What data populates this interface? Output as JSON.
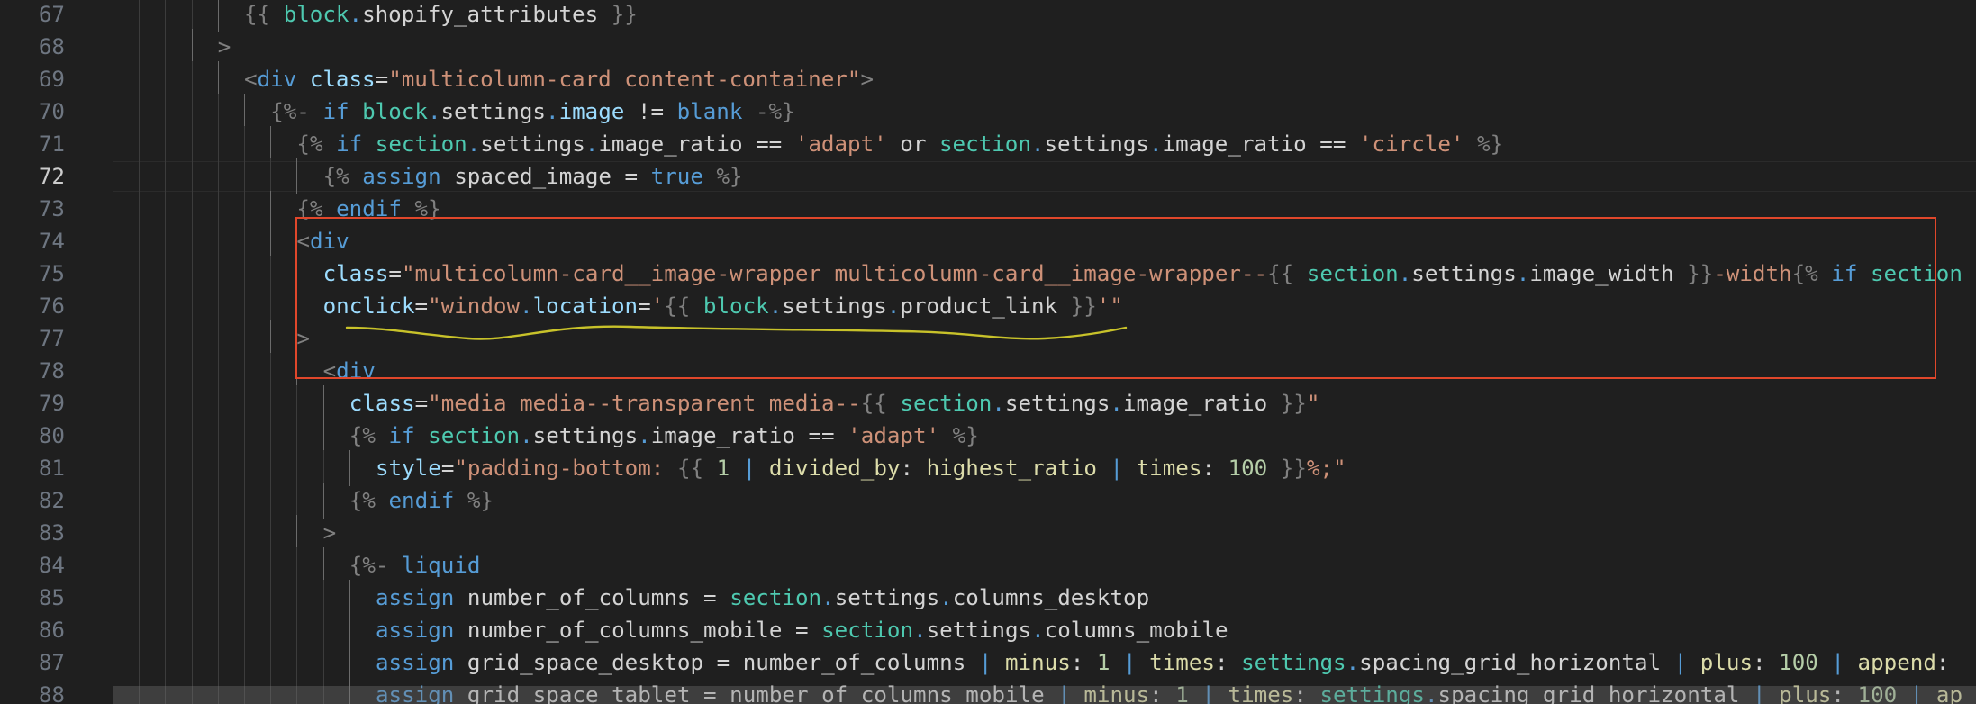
{
  "editor": {
    "current_line": 72,
    "lines": [
      {
        "number": 67,
        "indent": 5,
        "tokens": [
          {
            "t": "{{ ",
            "c": "liq"
          },
          {
            "t": "block",
            "c": "obj"
          },
          {
            "t": ".",
            "c": "dot"
          },
          {
            "t": "shopify_attributes",
            "c": "prop"
          },
          {
            "t": " }}",
            "c": "liq"
          }
        ]
      },
      {
        "number": 68,
        "indent": 4,
        "tokens": [
          {
            "t": ">",
            "c": "punct"
          }
        ]
      },
      {
        "number": 69,
        "indent": 5,
        "tokens": [
          {
            "t": "<",
            "c": "punct"
          },
          {
            "t": "div",
            "c": "tag"
          },
          {
            "t": " ",
            "c": "ident"
          },
          {
            "t": "class",
            "c": "attr"
          },
          {
            "t": "=",
            "c": "ident"
          },
          {
            "t": "\"multicolumn-card content-container\"",
            "c": "str"
          },
          {
            "t": ">",
            "c": "punct"
          }
        ]
      },
      {
        "number": 70,
        "indent": 6,
        "tokens": [
          {
            "t": "{%- ",
            "c": "liq"
          },
          {
            "t": "if",
            "c": "kw"
          },
          {
            "t": " ",
            "c": "ident"
          },
          {
            "t": "block",
            "c": "obj"
          },
          {
            "t": ".",
            "c": "dot"
          },
          {
            "t": "settings",
            "c": "prop"
          },
          {
            "t": ".",
            "c": "dot"
          },
          {
            "t": "image",
            "c": "var"
          },
          {
            "t": " != ",
            "c": "ident"
          },
          {
            "t": "blank",
            "c": "kw"
          },
          {
            "t": " -%}",
            "c": "liq"
          }
        ]
      },
      {
        "number": 71,
        "indent": 7,
        "tokens": [
          {
            "t": "{% ",
            "c": "liq"
          },
          {
            "t": "if",
            "c": "kw"
          },
          {
            "t": " ",
            "c": "ident"
          },
          {
            "t": "section",
            "c": "obj"
          },
          {
            "t": ".",
            "c": "dot"
          },
          {
            "t": "settings",
            "c": "prop"
          },
          {
            "t": ".",
            "c": "dot"
          },
          {
            "t": "image_ratio",
            "c": "prop"
          },
          {
            "t": " == ",
            "c": "ident"
          },
          {
            "t": "'adapt'",
            "c": "str"
          },
          {
            "t": " or ",
            "c": "ident"
          },
          {
            "t": "section",
            "c": "obj"
          },
          {
            "t": ".",
            "c": "dot"
          },
          {
            "t": "settings",
            "c": "prop"
          },
          {
            "t": ".",
            "c": "dot"
          },
          {
            "t": "image_ratio",
            "c": "prop"
          },
          {
            "t": " == ",
            "c": "ident"
          },
          {
            "t": "'circle'",
            "c": "str"
          },
          {
            "t": " %}",
            "c": "liq"
          }
        ]
      },
      {
        "number": 72,
        "indent": 8,
        "tokens": [
          {
            "t": "{% ",
            "c": "liq"
          },
          {
            "t": "assign",
            "c": "kw"
          },
          {
            "t": " spaced_image = ",
            "c": "ident"
          },
          {
            "t": "true",
            "c": "kw"
          },
          {
            "t": " %}",
            "c": "liq"
          }
        ]
      },
      {
        "number": 73,
        "indent": 7,
        "tokens": [
          {
            "t": "{% ",
            "c": "liq"
          },
          {
            "t": "endif",
            "c": "kw"
          },
          {
            "t": " %}",
            "c": "liq"
          }
        ]
      },
      {
        "number": 74,
        "indent": 7,
        "tokens": [
          {
            "t": "<",
            "c": "punct"
          },
          {
            "t": "div",
            "c": "tag"
          }
        ]
      },
      {
        "number": 75,
        "indent": 8,
        "tokens": [
          {
            "t": "class",
            "c": "attr"
          },
          {
            "t": "=",
            "c": "ident"
          },
          {
            "t": "\"multicolumn-card__image-wrapper multicolumn-card__image-wrapper--",
            "c": "str"
          },
          {
            "t": "{{ ",
            "c": "liq"
          },
          {
            "t": "section",
            "c": "obj"
          },
          {
            "t": ".",
            "c": "dot"
          },
          {
            "t": "settings",
            "c": "prop"
          },
          {
            "t": ".",
            "c": "dot"
          },
          {
            "t": "image_width",
            "c": "prop"
          },
          {
            "t": " }}",
            "c": "liq"
          },
          {
            "t": "-width",
            "c": "str"
          },
          {
            "t": "{% ",
            "c": "liq"
          },
          {
            "t": "if",
            "c": "kw"
          },
          {
            "t": " ",
            "c": "ident"
          },
          {
            "t": "section",
            "c": "obj"
          }
        ]
      },
      {
        "number": 76,
        "indent": 8,
        "tokens": [
          {
            "t": "onclick",
            "c": "attr"
          },
          {
            "t": "=",
            "c": "ident"
          },
          {
            "t": "\"window",
            "c": "str"
          },
          {
            "t": ".",
            "c": "dot"
          },
          {
            "t": "location",
            "c": "var"
          },
          {
            "t": "=",
            "c": "ident"
          },
          {
            "t": "'",
            "c": "str"
          },
          {
            "t": "{{ ",
            "c": "liq"
          },
          {
            "t": "block",
            "c": "obj"
          },
          {
            "t": ".",
            "c": "dot"
          },
          {
            "t": "settings",
            "c": "prop"
          },
          {
            "t": ".",
            "c": "dot"
          },
          {
            "t": "product_link",
            "c": "prop"
          },
          {
            "t": " }}",
            "c": "liq"
          },
          {
            "t": "'\"",
            "c": "str"
          }
        ]
      },
      {
        "number": 77,
        "indent": 7,
        "tokens": [
          {
            "t": ">",
            "c": "punct"
          }
        ]
      },
      {
        "number": 78,
        "indent": 8,
        "tokens": [
          {
            "t": "<",
            "c": "punct"
          },
          {
            "t": "div",
            "c": "tag"
          }
        ]
      },
      {
        "number": 79,
        "indent": 9,
        "tokens": [
          {
            "t": "class",
            "c": "attr"
          },
          {
            "t": "=",
            "c": "ident"
          },
          {
            "t": "\"media media--transparent media--",
            "c": "str"
          },
          {
            "t": "{{ ",
            "c": "liq"
          },
          {
            "t": "section",
            "c": "obj"
          },
          {
            "t": ".",
            "c": "dot"
          },
          {
            "t": "settings",
            "c": "prop"
          },
          {
            "t": ".",
            "c": "dot"
          },
          {
            "t": "image_ratio",
            "c": "prop"
          },
          {
            "t": " }}",
            "c": "liq"
          },
          {
            "t": "\"",
            "c": "str"
          }
        ]
      },
      {
        "number": 80,
        "indent": 9,
        "tokens": [
          {
            "t": "{% ",
            "c": "liq"
          },
          {
            "t": "if",
            "c": "kw"
          },
          {
            "t": " ",
            "c": "ident"
          },
          {
            "t": "section",
            "c": "obj"
          },
          {
            "t": ".",
            "c": "dot"
          },
          {
            "t": "settings",
            "c": "prop"
          },
          {
            "t": ".",
            "c": "dot"
          },
          {
            "t": "image_ratio",
            "c": "prop"
          },
          {
            "t": " == ",
            "c": "ident"
          },
          {
            "t": "'adapt'",
            "c": "str"
          },
          {
            "t": " %}",
            "c": "liq"
          }
        ]
      },
      {
        "number": 81,
        "indent": 10,
        "tokens": [
          {
            "t": "style",
            "c": "attr"
          },
          {
            "t": "=",
            "c": "ident"
          },
          {
            "t": "\"padding-bottom: ",
            "c": "str"
          },
          {
            "t": "{{ ",
            "c": "liq"
          },
          {
            "t": "1",
            "c": "num"
          },
          {
            "t": " | ",
            "c": "pipe"
          },
          {
            "t": "divided_by",
            "c": "filter"
          },
          {
            "t": ": ",
            "c": "ident"
          },
          {
            "t": "highest_ratio",
            "c": "filter"
          },
          {
            "t": " | ",
            "c": "pipe"
          },
          {
            "t": "times",
            "c": "filter"
          },
          {
            "t": ": ",
            "c": "ident"
          },
          {
            "t": "100",
            "c": "num"
          },
          {
            "t": " }}",
            "c": "liq"
          },
          {
            "t": "%;\"",
            "c": "str"
          }
        ]
      },
      {
        "number": 82,
        "indent": 9,
        "tokens": [
          {
            "t": "{% ",
            "c": "liq"
          },
          {
            "t": "endif",
            "c": "kw"
          },
          {
            "t": " %}",
            "c": "liq"
          }
        ]
      },
      {
        "number": 83,
        "indent": 8,
        "tokens": [
          {
            "t": ">",
            "c": "punct"
          }
        ]
      },
      {
        "number": 84,
        "indent": 9,
        "tokens": [
          {
            "t": "{%- ",
            "c": "liq"
          },
          {
            "t": "liquid",
            "c": "kw"
          }
        ]
      },
      {
        "number": 85,
        "indent": 10,
        "tokens": [
          {
            "t": "assign",
            "c": "kw"
          },
          {
            "t": " number_of_columns = ",
            "c": "ident"
          },
          {
            "t": "section",
            "c": "obj"
          },
          {
            "t": ".",
            "c": "dot"
          },
          {
            "t": "settings",
            "c": "prop"
          },
          {
            "t": ".",
            "c": "dot"
          },
          {
            "t": "columns_desktop",
            "c": "prop"
          }
        ]
      },
      {
        "number": 86,
        "indent": 10,
        "tokens": [
          {
            "t": "assign",
            "c": "kw"
          },
          {
            "t": " number_of_columns_mobile = ",
            "c": "ident"
          },
          {
            "t": "section",
            "c": "obj"
          },
          {
            "t": ".",
            "c": "dot"
          },
          {
            "t": "settings",
            "c": "prop"
          },
          {
            "t": ".",
            "c": "dot"
          },
          {
            "t": "columns_mobile",
            "c": "prop"
          }
        ]
      },
      {
        "number": 87,
        "indent": 10,
        "tokens": [
          {
            "t": "assign",
            "c": "kw"
          },
          {
            "t": " grid_space_desktop = number_of_columns ",
            "c": "ident"
          },
          {
            "t": "|",
            "c": "pipe"
          },
          {
            "t": " ",
            "c": "ident"
          },
          {
            "t": "minus",
            "c": "filter"
          },
          {
            "t": ": ",
            "c": "ident"
          },
          {
            "t": "1",
            "c": "num"
          },
          {
            "t": " | ",
            "c": "pipe"
          },
          {
            "t": "times",
            "c": "filter"
          },
          {
            "t": ": ",
            "c": "ident"
          },
          {
            "t": "settings",
            "c": "obj"
          },
          {
            "t": ".",
            "c": "dot"
          },
          {
            "t": "spacing_grid_horizontal",
            "c": "prop"
          },
          {
            "t": " | ",
            "c": "pipe"
          },
          {
            "t": "plus",
            "c": "filter"
          },
          {
            "t": ": ",
            "c": "ident"
          },
          {
            "t": "100",
            "c": "num"
          },
          {
            "t": " | ",
            "c": "pipe"
          },
          {
            "t": "append",
            "c": "filter"
          },
          {
            "t": ":",
            "c": "ident"
          }
        ]
      },
      {
        "number": 88,
        "indent": 10,
        "tokens": [
          {
            "t": "assign",
            "c": "kw"
          },
          {
            "t": " grid_space_tablet = number_of_columns_mobile ",
            "c": "ident"
          },
          {
            "t": "|",
            "c": "pipe"
          },
          {
            "t": " ",
            "c": "ident"
          },
          {
            "t": "minus",
            "c": "filter"
          },
          {
            "t": ": ",
            "c": "ident"
          },
          {
            "t": "1",
            "c": "num"
          },
          {
            "t": " | ",
            "c": "pipe"
          },
          {
            "t": "times",
            "c": "filter"
          },
          {
            "t": ": ",
            "c": "ident"
          },
          {
            "t": "settings",
            "c": "obj"
          },
          {
            "t": ".",
            "c": "dot"
          },
          {
            "t": "spacing_grid_horizontal",
            "c": "prop"
          },
          {
            "t": " | ",
            "c": "pipe"
          },
          {
            "t": "plus",
            "c": "filter"
          },
          {
            "t": ": ",
            "c": "ident"
          },
          {
            "t": "100",
            "c": "num"
          },
          {
            "t": " | ",
            "c": "pipe"
          },
          {
            "t": "ap",
            "c": "filter"
          }
        ]
      }
    ]
  },
  "annotations": {
    "box_color": "#e0472b",
    "underline_color": "#c8c22a"
  }
}
